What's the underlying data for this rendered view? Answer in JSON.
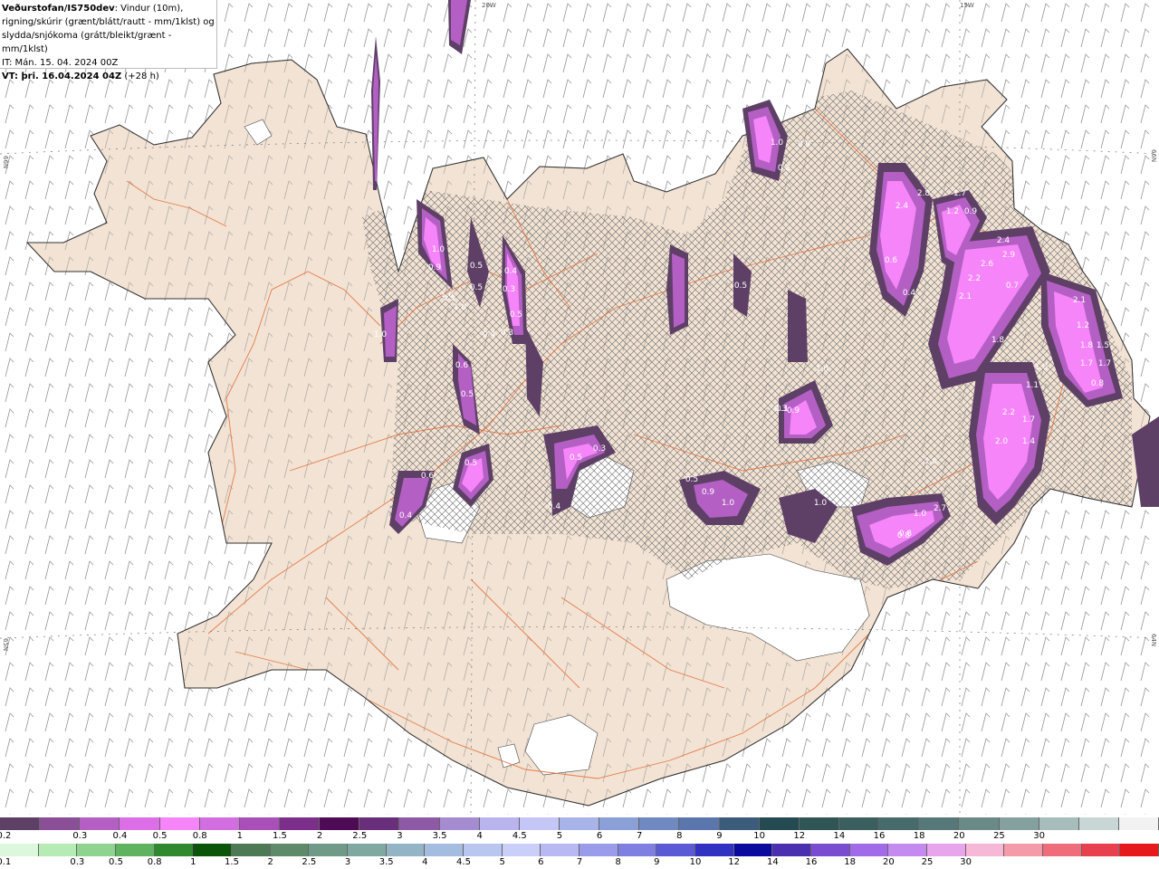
{
  "header": {
    "agency": "Veðurstofan/IS750dev",
    "desc_line1": ": Vindur (10m),",
    "desc_line2": "rigning/skúrir (grænt/blátt/rautt - mm/1klst) og",
    "desc_line3": "slydda/snjókoma (grátt/bleikt/grænt - mm/1klst)",
    "it": "IT: Mán. 15. 04. 2024 00Z",
    "vt_bold": "VT: þri. 16.04.2024 04Z",
    "vt_rest": " (+28 h)"
  },
  "graticule": {
    "lon_top": [
      "20W",
      "15W"
    ],
    "lat_left": [
      "66N",
      "65N"
    ],
    "lat_right": [
      "66N",
      "64N"
    ]
  },
  "legend_snow": {
    "colors": [
      "#5e4066",
      "#8a4f96",
      "#b45fc4",
      "#dc6fe8",
      "#f585f8",
      "#d36ee0",
      "#a94fb8",
      "#7b2e8a",
      "#4d0a55",
      "#6a2f7a",
      "#8e5aa6",
      "#a58bd0",
      "#b9b3ee",
      "#c3c6f6",
      "#a8b4e8",
      "#8ba0d6",
      "#7089c0",
      "#5a76ad",
      "#3b5c7a",
      "#244a52",
      "#2f5555",
      "#3b5f5f",
      "#476a6a",
      "#577878",
      "#6a8a88",
      "#84a09f",
      "#a7bdbc",
      "#c8d6d5",
      "#f2f2f2"
    ],
    "labels": [
      "0.2",
      "0.3",
      "0.4",
      "0.5",
      "0.8",
      "1",
      "1.5",
      "2",
      "2.5",
      "3",
      "3.5",
      "4",
      "4.5",
      "5",
      "6",
      "7",
      "8",
      "9",
      "10",
      "12",
      "14",
      "16",
      "18",
      "20",
      "25",
      "30"
    ]
  },
  "legend_rain": {
    "colors": [
      "#dcf7dc",
      "#b6ebb6",
      "#8ed38e",
      "#5fb35f",
      "#2f8a2f",
      "#0b550b",
      "#4d7a55",
      "#5f8a6a",
      "#6f9a88",
      "#7fa8a0",
      "#93b4c4",
      "#a4bce0",
      "#b9c7f0",
      "#c9cff8",
      "#b8b8f5",
      "#9b9bec",
      "#7f7fe2",
      "#5a5ad6",
      "#3232c2",
      "#0a0a9e",
      "#4a2fb0",
      "#7a4dd0",
      "#a06ae8",
      "#c48af0",
      "#e8a4ec",
      "#f7b8d8",
      "#f59aa8",
      "#ef6d7a",
      "#e8404e",
      "#e61a1a"
    ],
    "labels": [
      "0.1",
      "0.3",
      "0.5",
      "0.8",
      "1",
      "1.5",
      "2",
      "2.5",
      "3",
      "3.5",
      "4",
      "4.5",
      "5",
      "6",
      "7",
      "8",
      "9",
      "10",
      "12",
      "14",
      "16",
      "18",
      "20",
      "25",
      "30"
    ]
  },
  "precip_labels": [
    "1.0",
    "0.9",
    "0.5",
    "1.0",
    "1.0",
    "0.5",
    "0.3",
    "0.4",
    "0.3",
    "0.5",
    "0.6",
    "0.5",
    "1.0",
    "0.6",
    "0.3",
    "0.4",
    "0.5",
    "0.4",
    "0.5",
    "0.3",
    "0.4",
    "0.5",
    "0.9",
    "1.0",
    "1.0",
    "0.3",
    "0.9",
    "0.2",
    "1.0",
    "0.9",
    "1.0",
    "0.8",
    "2.4",
    "2.8",
    "1.7",
    "1.2",
    "0.9",
    "0.6",
    "0.4",
    "2.6",
    "2.2",
    "2.1",
    "2.4",
    "2.9",
    "0.7",
    "1.8",
    "2.1",
    "1.2",
    "1.8",
    "1.5",
    "1.7",
    "1.7",
    "0.8",
    "1.0",
    "1.1",
    "2.2",
    "1.7",
    "1.4",
    "2.0",
    "1.0",
    "0.1",
    "0.5",
    "1.0",
    "2.7",
    "0.8"
  ]
}
